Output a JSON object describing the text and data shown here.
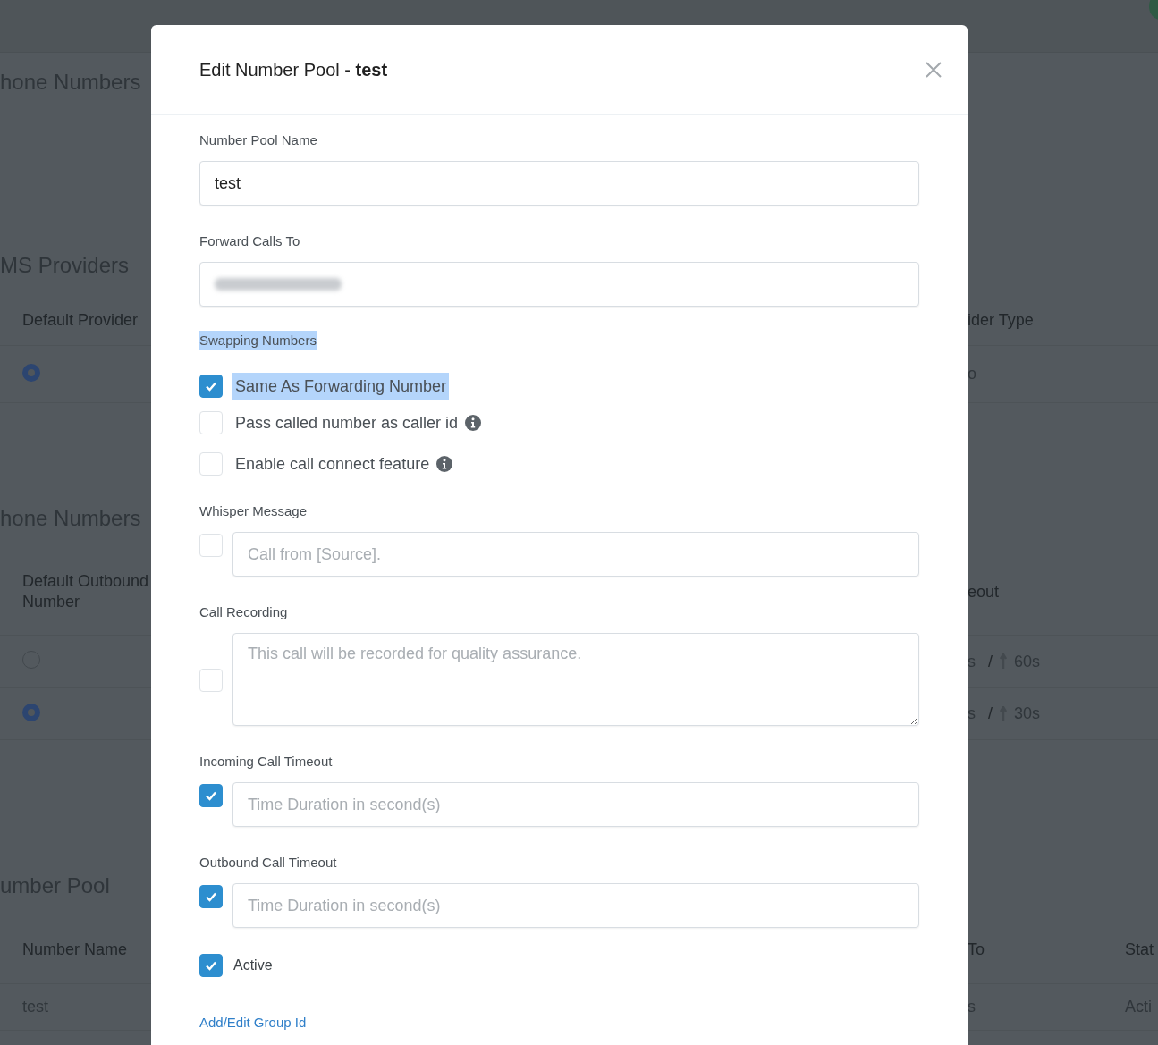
{
  "background_page": {
    "rows": [
      {
        "kind": "heading",
        "text": "hone Numbers"
      },
      {
        "kind": "heading",
        "text": "MS Providers"
      },
      {
        "kind": "header",
        "cells": [
          "Default Provider",
          "ider Type"
        ]
      },
      {
        "kind": "radio",
        "selected": true,
        "text": "o"
      },
      {
        "kind": "heading",
        "text": "hone Numbers"
      },
      {
        "kind": "header",
        "cells": [
          "Default Outbound Number",
          "eout"
        ]
      },
      {
        "kind": "radio",
        "selected": false,
        "timeout_in": "s",
        "separator": "/",
        "timeout_out": "60s"
      },
      {
        "kind": "radio",
        "selected": true,
        "timeout_in": "s",
        "separator": "/",
        "timeout_out": "30s"
      },
      {
        "kind": "heading",
        "text": "umber Pool"
      },
      {
        "kind": "header",
        "cells": [
          "Number Name",
          "To",
          "Stat"
        ]
      },
      {
        "kind": "cells",
        "cells": [
          "test",
          "s",
          "Acti"
        ]
      }
    ]
  },
  "modal": {
    "title": "Edit Number Pool - **test**",
    "fields": [
      {
        "kind": "text",
        "label": "Number Pool Name",
        "value": "test"
      },
      {
        "kind": "text",
        "label": "Forward Calls To",
        "value_blurred": true
      },
      {
        "kind": "checkgroup",
        "label": "Swapping Numbers",
        "label_highlighted": true,
        "options": [
          {
            "label": "Same As Forwarding Number",
            "checked": true,
            "highlighted": true,
            "info": false
          },
          {
            "label": "Pass called number as caller id",
            "checked": false,
            "highlighted": false,
            "info": true
          },
          {
            "label": "Enable call connect feature",
            "checked": false,
            "highlighted": false,
            "info": true
          }
        ]
      },
      {
        "kind": "check_input",
        "label": "Whisper Message",
        "checked": false,
        "placeholder": "Call from [Source]."
      },
      {
        "kind": "check_textarea",
        "label": "Call Recording",
        "checked": false,
        "placeholder": "This call will be recorded for quality assurance."
      },
      {
        "kind": "check_input",
        "label": "Incoming Call Timeout",
        "checked": true,
        "placeholder": "Time Duration in second(s)"
      },
      {
        "kind": "check_input",
        "label": "Outbound Call Timeout",
        "checked": true,
        "placeholder": "Time Duration in second(s)"
      },
      {
        "kind": "checkbox",
        "label": "Active",
        "checked": true
      },
      {
        "kind": "link",
        "label": "Add/Edit Group Id"
      }
    ]
  }
}
